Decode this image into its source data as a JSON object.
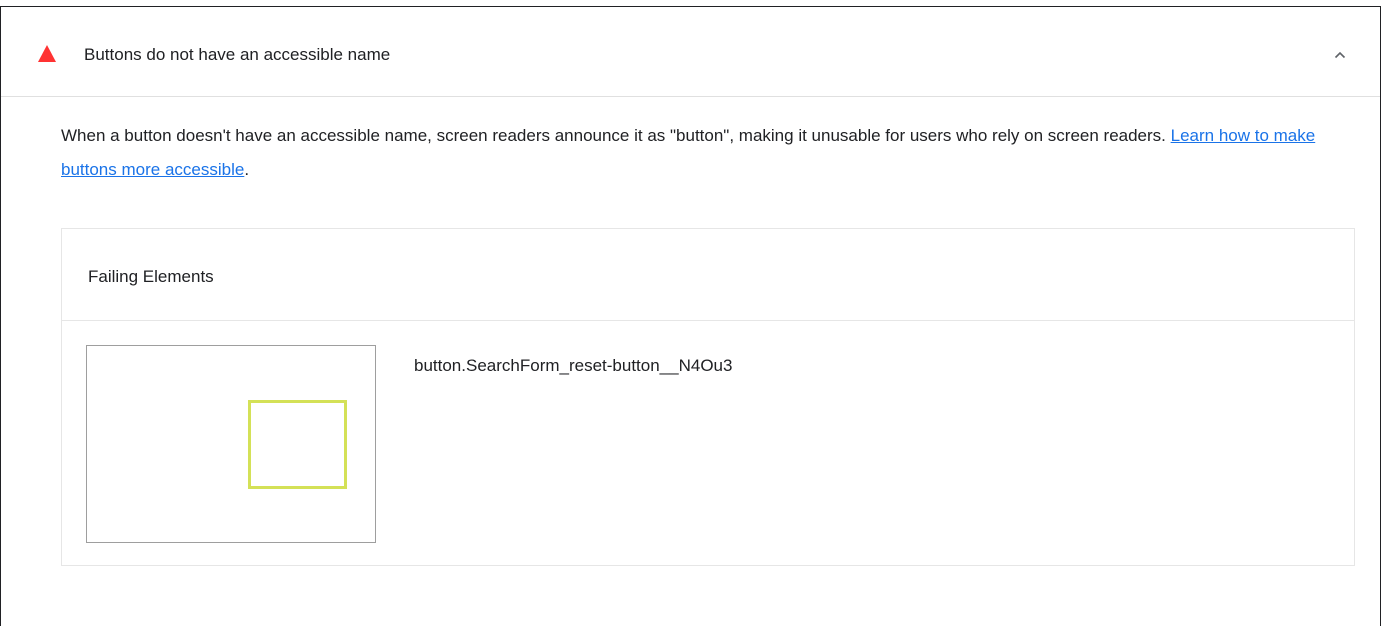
{
  "audit": {
    "title": "Buttons do not have an accessible name",
    "status_color": "#ff3333",
    "expand_icon": "chevron-up-icon",
    "description_text": "When a button doesn't have an accessible name, screen readers announce it as \"button\", making it unusable for users who rely on screen readers. ",
    "learn_more_link": "Learn how to make buttons more accessible",
    "description_end": "."
  },
  "details": {
    "title": "Failing Elements",
    "items": [
      {
        "node_label": "button.SearchForm_reset-button__N4Ou3",
        "highlight_color": "#d4e157"
      }
    ]
  },
  "colors": {
    "link": "#1a73e8",
    "fail": "#ff3333",
    "highlight": "#d4e157"
  }
}
